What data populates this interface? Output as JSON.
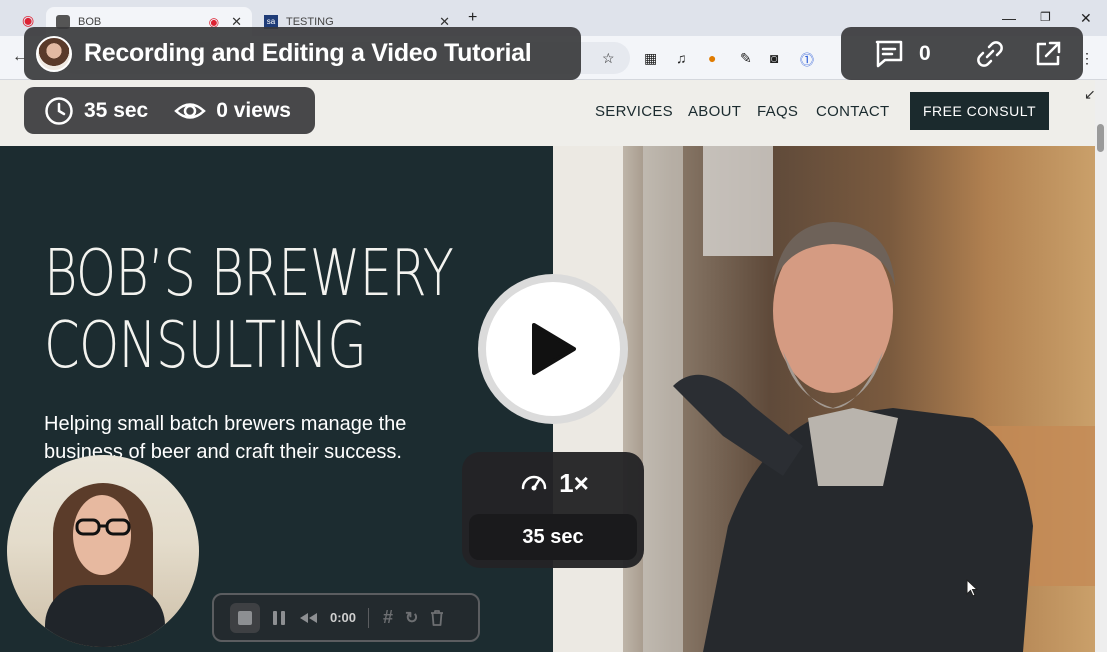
{
  "browser": {
    "tabs": [
      {
        "label": "BOB",
        "active": true
      },
      {
        "label": "TESTING",
        "active": false
      }
    ],
    "favicon_sa": "sa"
  },
  "site": {
    "nav": [
      "SERVICES",
      "ABOUT",
      "FAQS",
      "CONTACT"
    ],
    "cta": "FREE CONSULT",
    "hero_title_line1": "BOB’S BREWERY",
    "hero_title_line2": "CONSULTING",
    "hero_subtitle": "Helping small batch brewers manage the business of beer and craft their success."
  },
  "player": {
    "title": "Recording and Editing a Video Tutorial",
    "duration": "35 sec",
    "views": "0 views",
    "comments_count": "0",
    "speed": "1×",
    "speed_duration": "35 sec",
    "rec_time": "0:00"
  },
  "colors": {
    "hero_dark": "#1c2c30",
    "overlay": "#3a3a3c",
    "cta_bg": "#1b2a2d"
  }
}
